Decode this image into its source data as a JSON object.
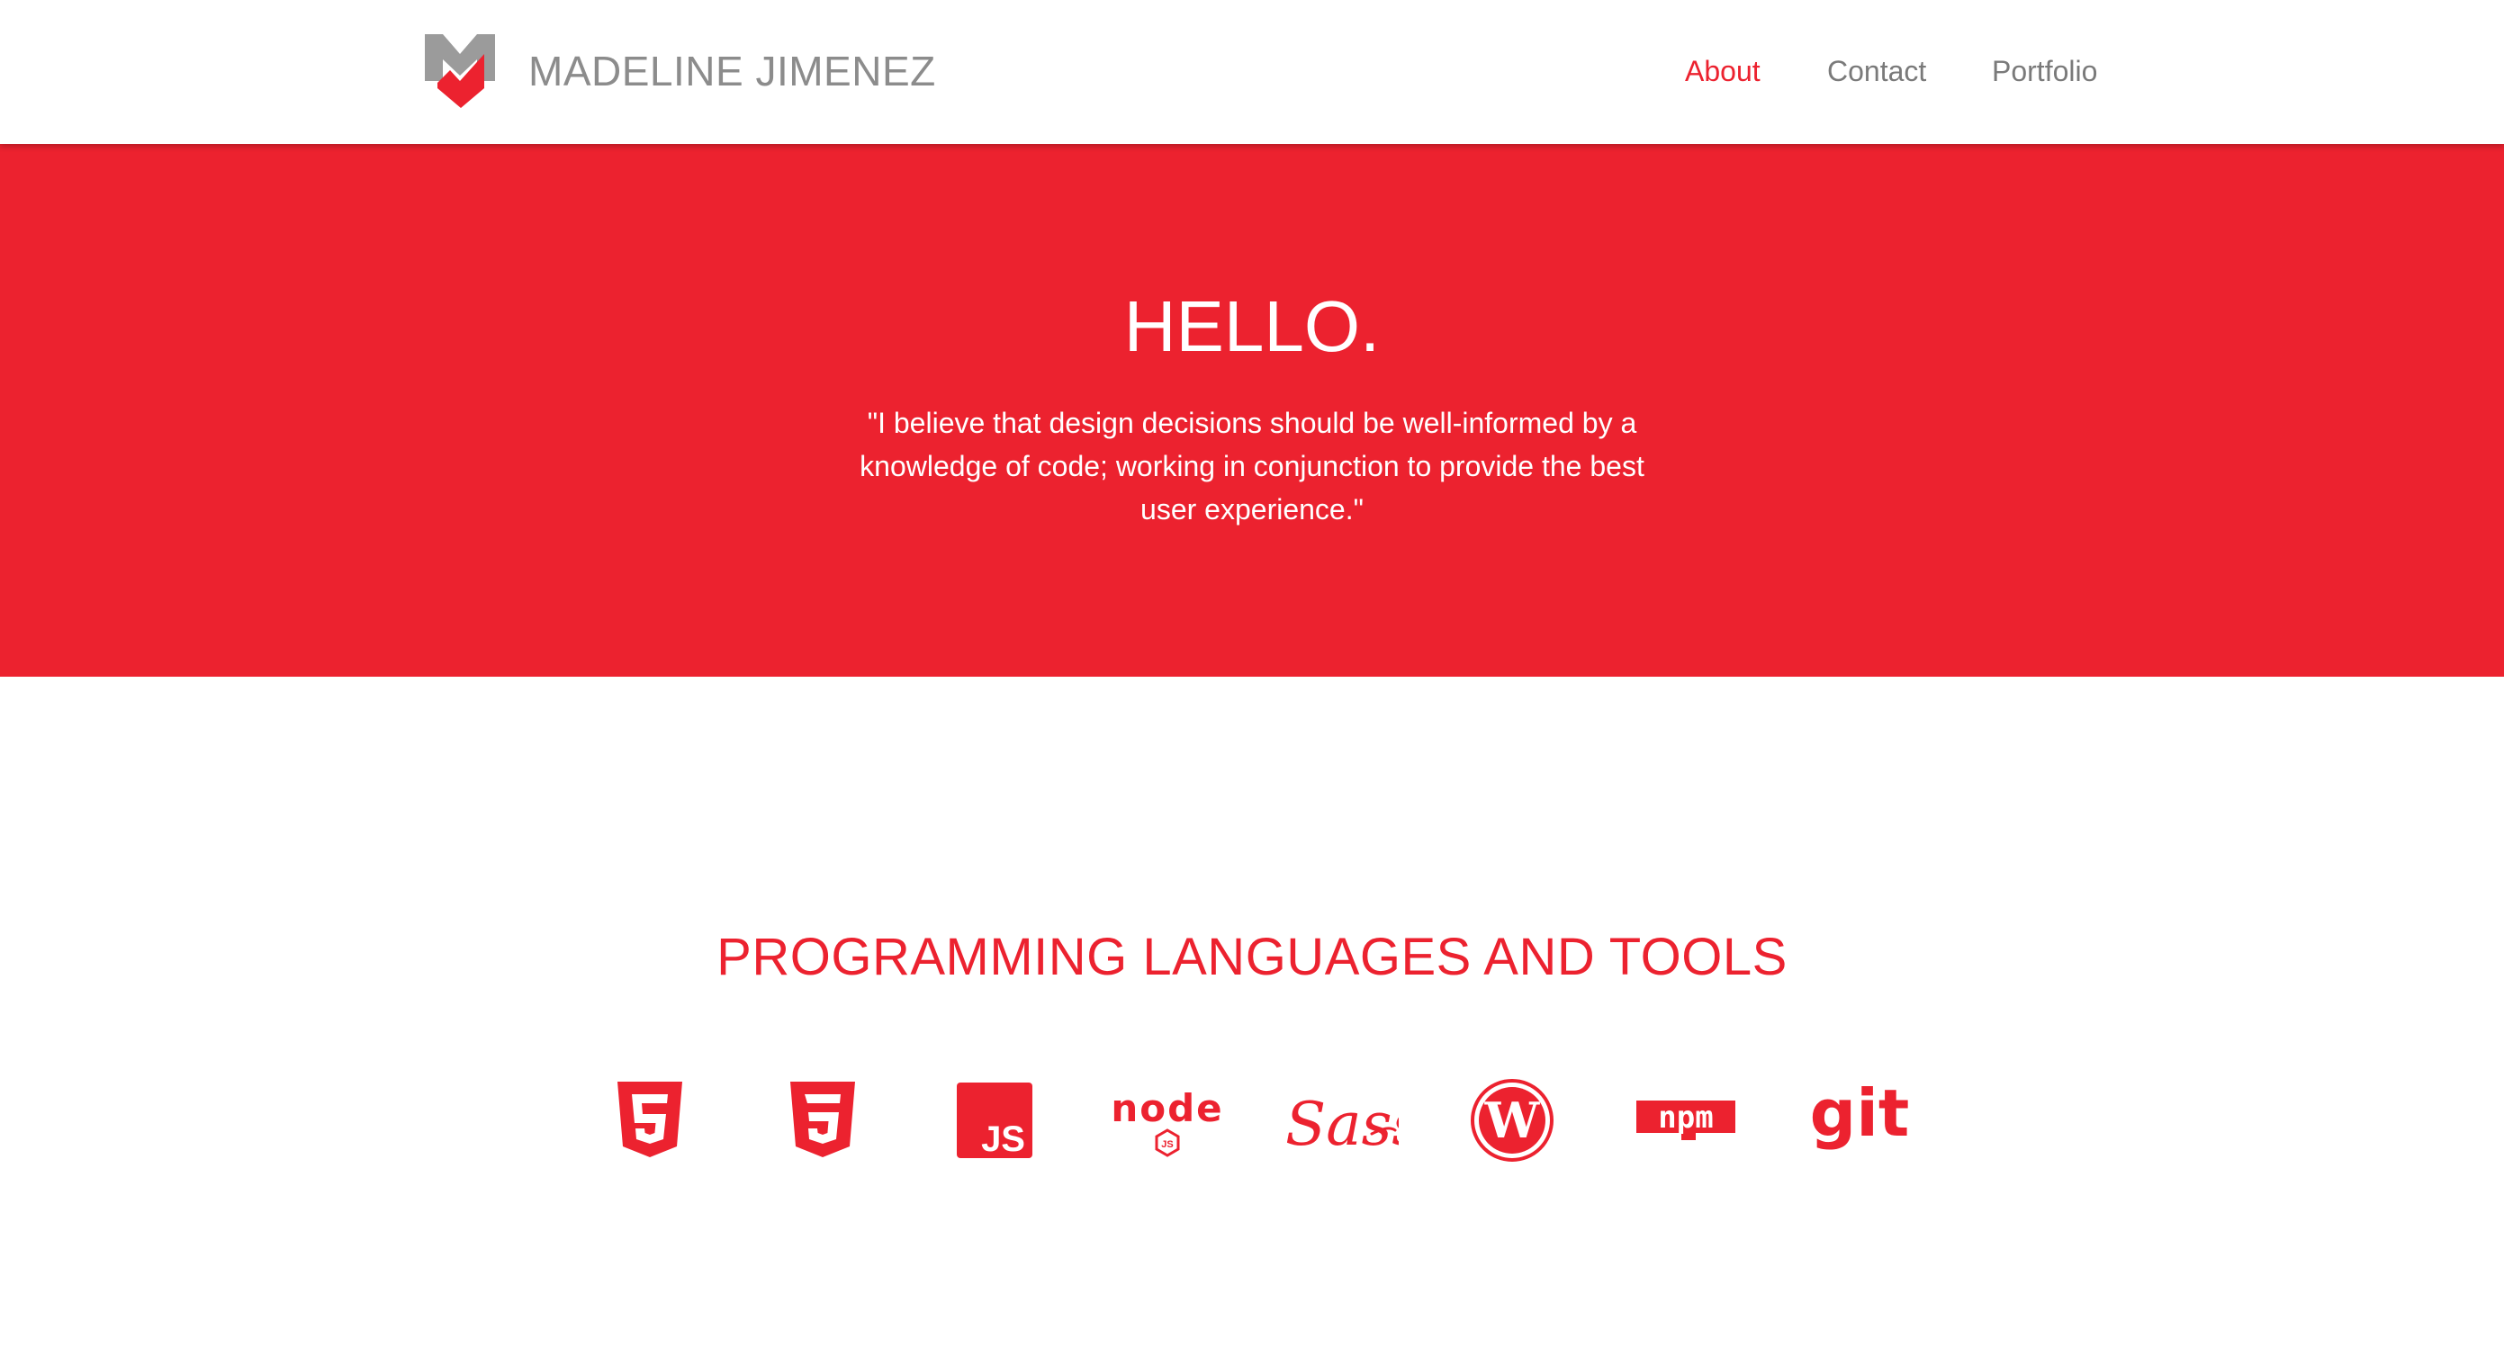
{
  "header": {
    "brand_name": "MADELINE JIMENEZ",
    "nav": [
      {
        "label": "About",
        "active": true
      },
      {
        "label": "Contact",
        "active": false
      },
      {
        "label": "Portfolio",
        "active": false
      }
    ]
  },
  "hero": {
    "title": "HELLO.",
    "quote": "\"I believe that design decisions should be well-informed by a knowledge of code; working in conjunction to provide the best user experience.\""
  },
  "tools": {
    "heading": "PROGRAMMING LANGUAGES AND TOOLS",
    "items": [
      {
        "icon": "html5-icon"
      },
      {
        "icon": "css3-icon"
      },
      {
        "icon": "javascript-icon",
        "text": "JS"
      },
      {
        "icon": "nodejs-icon",
        "text": "node",
        "subtext": "JS"
      },
      {
        "icon": "sass-icon",
        "text": "Sass"
      },
      {
        "icon": "wordpress-icon",
        "text": "W"
      },
      {
        "icon": "npm-icon",
        "text": "npm"
      },
      {
        "icon": "git-icon",
        "text": "git"
      }
    ]
  },
  "colors": {
    "accent": "#ec222f",
    "logo_gray": "#9b9b9b",
    "nav_gray": "#7a7a7a",
    "brand_gray": "#8c8c8c",
    "background": "#ffffff"
  }
}
